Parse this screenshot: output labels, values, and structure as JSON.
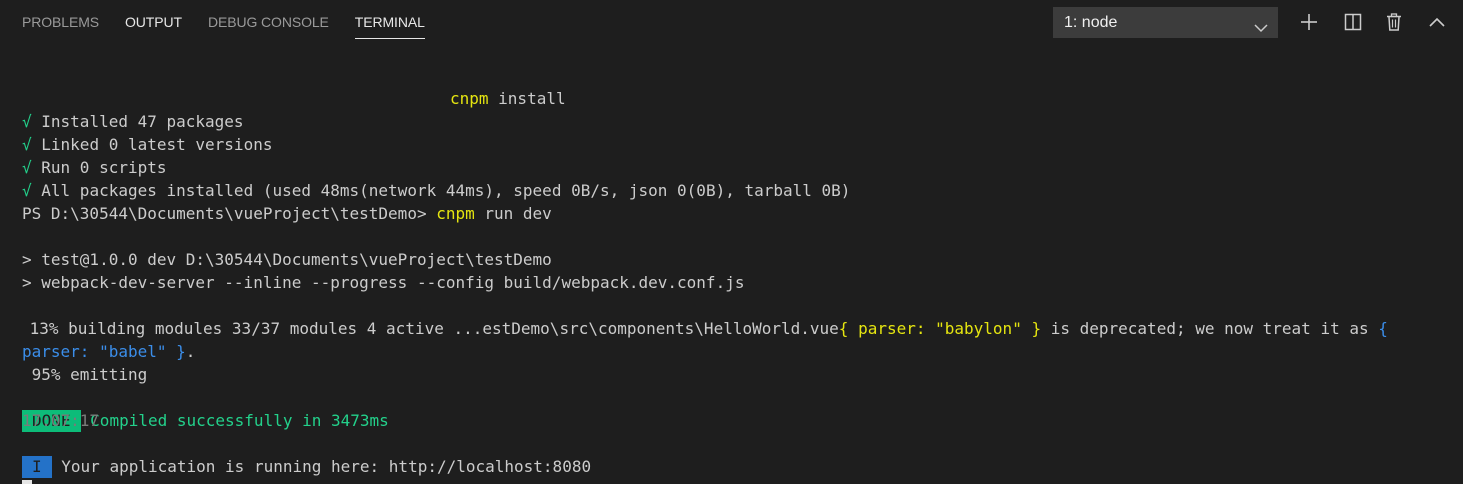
{
  "tabs": {
    "problems": "PROBLEMS",
    "output": "OUTPUT",
    "debug_console": "DEBUG CONSOLE",
    "terminal": "TERMINAL"
  },
  "terminal_selector": {
    "selected": "1: node"
  },
  "actions": {
    "icons": [
      "plus-icon",
      "split-icon",
      "trash-icon",
      "chevron-up-icon"
    ]
  },
  "colors": {
    "background": "#1e1e1e",
    "yellow": "#e5e510",
    "blue": "#3b8eea",
    "green": "#23d18b",
    "done_badge": "#0dbc79",
    "info_badge": "#2472c8"
  },
  "terminal": {
    "cnpm_cmd": "cnpm",
    "cnpm_arg": " install",
    "check": "√",
    "installed": " Installed 47 packages",
    "linked": " Linked 0 latest versions",
    "run_scripts": " Run 0 scripts",
    "all_packages": " All packages installed (used 48ms(network 44ms), speed 0B/s, json 0(0B), tarball 0B)",
    "prompt": "PS D:\\30544\\Documents\\vueProject\\testDemo> ",
    "prompt_cmd": "cnpm",
    "prompt_arg": " run dev",
    "script_line1": "> test@1.0.0 dev D:\\30544\\Documents\\vueProject\\testDemo",
    "script_line2": "> webpack-dev-server --inline --progress --config build/webpack.dev.conf.js",
    "building_prefix": " 13% building modules 33/37 modules 4 active ...estDemo\\src\\components\\HelloWorld.vue",
    "building_yellow": "{ parser: \"babylon\" }",
    "building_mid": " is deprecated; we now treat it as ",
    "building_blue_start": "{",
    "building_blue_cont": "parser: \"babel\" }",
    "building_end": ".",
    "emitting": " 95% emitting",
    "done_label": "DONE",
    "compiled": "Compiled successfully in 3473ms",
    "timestamp": "17:07:17",
    "info_label": "I",
    "running": "Your application is running here: http://localhost:8080"
  }
}
